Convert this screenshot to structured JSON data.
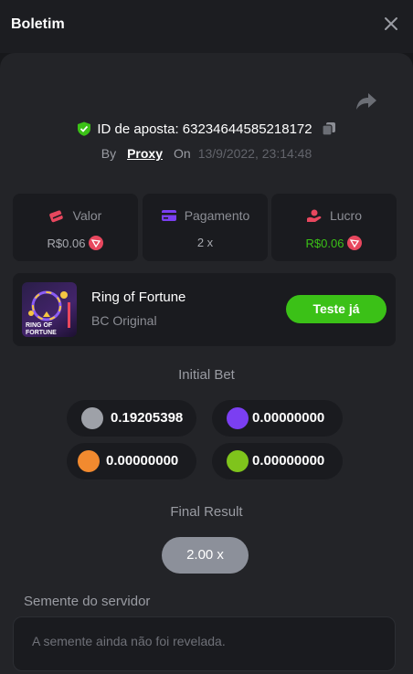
{
  "window": {
    "title": "Boletim"
  },
  "bet": {
    "id_label": "ID de aposta: 63234644585218172",
    "by_label": "By",
    "username": "Proxy",
    "on_label": "On",
    "datetime": "13/9/2022, 23:14:48"
  },
  "stats": [
    {
      "label": "Valor",
      "value": "R$0.06",
      "icon": "money-icon"
    },
    {
      "label": "Pagamento",
      "value": "2 x",
      "icon": "card-icon"
    },
    {
      "label": "Lucro",
      "value": "R$0.06",
      "icon": "profit-icon"
    }
  ],
  "game": {
    "name": "Ring of Fortune",
    "provider": "BC Original",
    "play_label": "Teste já",
    "thumb_text": "RING OF FORTUNE"
  },
  "initial_bet": {
    "title": "Initial Bet",
    "chips": [
      {
        "value": "0.19205398",
        "color": "#9ea1a8"
      },
      {
        "value": "0.00000000",
        "color": "#7b3ff2"
      },
      {
        "value": "0.00000000",
        "color": "#f28a2f"
      },
      {
        "value": "0.00000000",
        "color": "#7fc41c"
      }
    ]
  },
  "final_result": {
    "title": "Final Result",
    "value": "2.00 x"
  },
  "server_seed": {
    "title": "Semente do servidor",
    "placeholder": "A semente ainda não foi revelada."
  },
  "colors": {
    "accent_green": "#3bc117",
    "coin_red": "#e8475e"
  }
}
